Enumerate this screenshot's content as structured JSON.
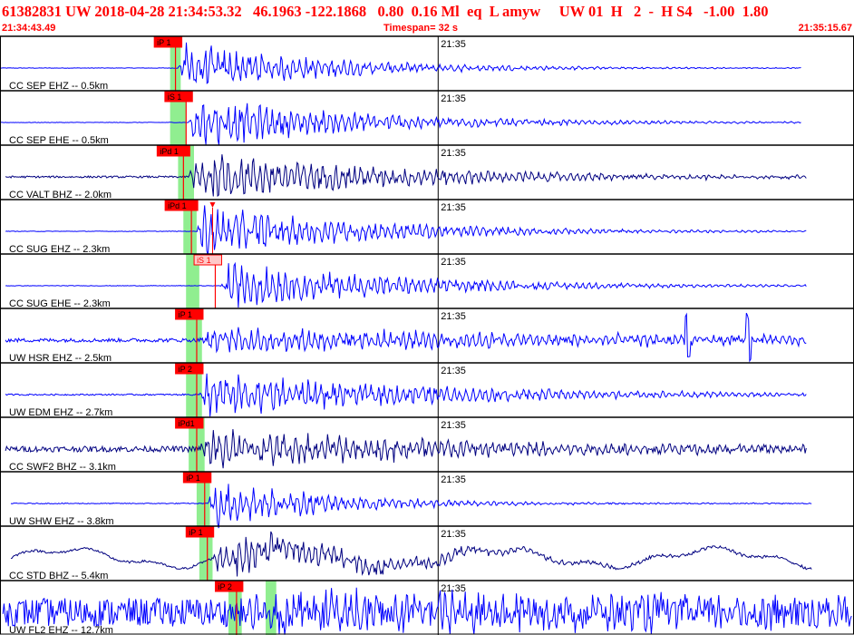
{
  "header": {
    "title": "61382831 UW 2018-04-28 21:34:53.32   46.1963 -122.1868   0.80  0.16 Ml  eq  L amyw     UW 01  H   2  -  H S4   -1.00  1.80",
    "start_time": "21:34:43.49",
    "timespan": "Timespan=  32 s",
    "end_time": "21:35:15.67"
  },
  "colors": {
    "trace_blue": "#0000ff",
    "trace_dark": "#000080",
    "pick_red": "#ff0000",
    "pick_fill_light": "#ffc8c8",
    "window_green": "#90ee90",
    "header_red": "#ff0000"
  },
  "chart_data": {
    "type": "seismogram",
    "time_start": "21:34:43.49",
    "time_end": "21:35:15.67",
    "timespan_s": 32,
    "minute_mark_label": "21:35",
    "minute_mark_time": "21:35:00.00",
    "traces": [
      {
        "label": "CC SEP EHZ -- 0.5km",
        "color": "blue",
        "pick": "iP 1",
        "pick_time": "21:34:50.00",
        "arrival_time": "21:34:50.20",
        "green_start": "21:34:49.90",
        "green_end": "21:34:50.30",
        "trace_start": "21:34:43.50",
        "trace_end": "21:35:13.70",
        "noise": 0.01,
        "peak": 1.0,
        "decay_s": 5.5
      },
      {
        "label": "CC SEP EHE -- 0.5km",
        "color": "blue",
        "pick": "iS 1",
        "pick_time": "21:34:50.40",
        "arrival_time": "21:34:50.60",
        "green_start": "21:34:49.90",
        "green_end": "21:34:50.50",
        "trace_start": "21:34:43.50",
        "trace_end": "21:35:13.70",
        "noise": 0.01,
        "peak": 1.0,
        "decay_s": 6.5
      },
      {
        "label": "CC VALT BHZ -- 2.0km",
        "color": "dark",
        "pick": "iPd 1",
        "pick_time": "21:34:50.30",
        "arrival_time": "21:34:50.60",
        "green_start": "21:34:50.20",
        "green_end": "21:34:50.80",
        "trace_start": "21:34:43.70",
        "trace_end": "21:35:13.90",
        "noise": 0.04,
        "peak": 1.0,
        "decay_s": 8.0
      },
      {
        "label": "CC SUG EHZ -- 2.3km",
        "color": "blue",
        "pick": "iPd 1",
        "pick_time": "21:34:50.60",
        "arrival_time": "21:34:50.90",
        "green_start": "21:34:50.40",
        "green_end": "21:34:50.90",
        "s_arrival_time": "21:34:51.50",
        "trace_start": "21:34:43.70",
        "trace_end": "21:35:13.90",
        "noise": 0.01,
        "peak": 1.0,
        "decay_s": 6.5
      },
      {
        "label": "CC SUG EHE -- 2.3km",
        "color": "blue",
        "pick": "iS 1",
        "pick_s": true,
        "pick_time": "21:34:51.50",
        "arrival_time": "21:34:51.80",
        "green_start": "21:34:50.50",
        "green_end": "21:34:51.00",
        "trace_start": "21:34:43.70",
        "trace_end": "21:35:13.90",
        "noise": 0.01,
        "peak": 0.9,
        "decay_s": 7.0
      },
      {
        "label": "UW HSR EHZ -- 2.5km",
        "color": "blue",
        "pick": "iP 1",
        "pick_time": "21:34:50.80",
        "arrival_time": "21:34:51.00",
        "green_start": "21:34:50.50",
        "green_end": "21:34:51.10",
        "trace_start": "21:34:43.70",
        "trace_end": "21:35:13.90",
        "noise": 0.08,
        "peak": 0.5,
        "decay_s": 20.0,
        "spikes": [
          "21:35:09.40",
          "21:35:11.70"
        ]
      },
      {
        "label": "UW EDM EHZ -- 2.7km",
        "color": "blue",
        "pick": "iP 2",
        "pick_time": "21:34:50.80",
        "arrival_time": "21:34:51.00",
        "green_start": "21:34:50.50",
        "green_end": "21:34:51.10",
        "trace_start": "21:34:43.70",
        "trace_end": "21:35:13.90",
        "noise": 0.03,
        "peak": 0.9,
        "decay_s": 9.0
      },
      {
        "label": "CC SWF2 BHZ -- 3.1km",
        "color": "dark",
        "pick": "iPd1",
        "pick_time": "21:34:50.80",
        "arrival_time": "21:34:51.00",
        "green_start": "21:34:50.60",
        "green_end": "21:34:51.20",
        "trace_start": "21:34:43.70",
        "trace_end": "21:35:13.90",
        "noise": 0.12,
        "peak": 0.8,
        "decay_s": 12.0
      },
      {
        "label": "UW SHW EHZ -- 3.8km",
        "color": "blue",
        "pick": "iP 1",
        "pick_time": "21:34:51.10",
        "arrival_time": "21:34:51.30",
        "green_start": "21:34:50.90",
        "green_end": "21:34:51.40",
        "trace_start": "21:34:43.90",
        "trace_end": "21:35:14.10",
        "noise": 0.02,
        "peak": 1.0,
        "decay_s": 4.5
      },
      {
        "label": "CC STD BHZ -- 5.4km",
        "color": "dark",
        "pick": "iP 1",
        "pick_time": "21:34:51.20",
        "arrival_time": "21:34:51.50",
        "green_start": "21:34:51.00",
        "green_end": "21:34:51.50",
        "trace_start": "21:34:43.90",
        "trace_end": "21:35:14.10",
        "noise": 0.05,
        "peak": 0.9,
        "decay_s": 6.0,
        "long_period": 0.35
      },
      {
        "label": "UW FL2 EHZ -- 12.7km",
        "color": "blue",
        "pick": "iP 2",
        "pick_time": "21:34:52.30",
        "arrival_time": "21:34:52.60",
        "green_start": "21:34:52.10",
        "green_end": "21:34:52.60",
        "green2_start": "21:34:53.50",
        "green2_end": "21:34:53.90",
        "trace_start": "21:34:43.60",
        "trace_end": "21:35:15.60",
        "noise": 0.6,
        "peak": 0.6,
        "decay_s": 30.0
      }
    ]
  }
}
